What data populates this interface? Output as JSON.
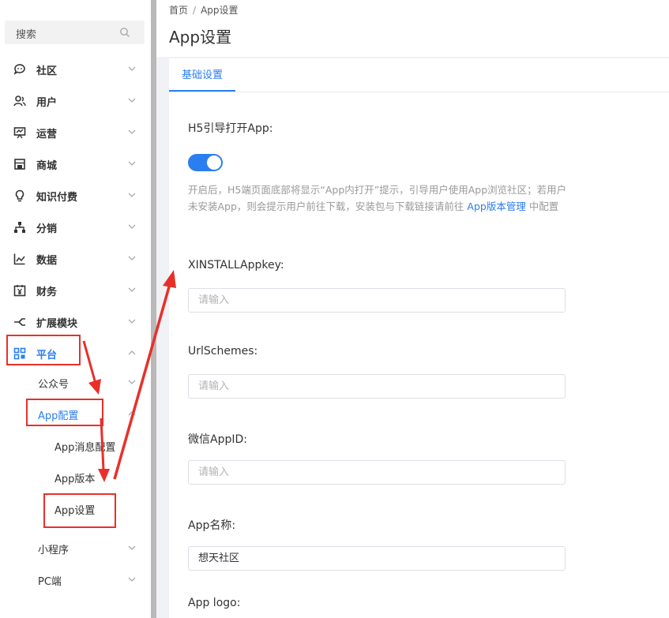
{
  "sidebar": {
    "search_placeholder": "搜索",
    "items": [
      {
        "label": "社区",
        "icon": "chat-icon"
      },
      {
        "label": "用户",
        "icon": "users-icon"
      },
      {
        "label": "运营",
        "icon": "presentation-icon"
      },
      {
        "label": "商城",
        "icon": "store-icon"
      },
      {
        "label": "知识付费",
        "icon": "lightbulb-icon"
      },
      {
        "label": "分销",
        "icon": "hierarchy-icon"
      },
      {
        "label": "数据",
        "icon": "chart-icon"
      },
      {
        "label": "财务",
        "icon": "yuan-calendar-icon"
      },
      {
        "label": "扩展模块",
        "icon": "extension-icon"
      },
      {
        "label": "平台",
        "icon": "grid-icon"
      }
    ],
    "platform_sub": {
      "gongzhonghao": "公众号",
      "app_config": "App配置",
      "app_msg_config": "App消息配置",
      "app_version": "App版本",
      "app_settings": "App设置",
      "mini_program": "小程序",
      "pc": "PC端"
    },
    "accent_color": "#2b7ef0"
  },
  "breadcrumb": {
    "home": "首页",
    "sep": "/",
    "current": "App设置"
  },
  "page_title": "App设置",
  "tabs": [
    {
      "label": "基础设置"
    }
  ],
  "form": {
    "h5_label": "H5引导打开App:",
    "h5_toggle_on": true,
    "help_text": "开启后，H5端页面底部将显示“App内打开”提示，引导用户使用App浏览社区；若用户未安装App，则会提示用户前往下载，安装包与下载链接请前往",
    "help_link": "App版本管理",
    "help_suffix": " 中配置",
    "xinstall_label": "XINSTALLAppkey:",
    "xinstall_placeholder": "请输入",
    "urlschemes_label": "UrlSchemes:",
    "urlschemes_placeholder": "请输入",
    "wechat_label": "微信AppID:",
    "wechat_placeholder": "请输入",
    "appname_label": "App名称:",
    "appname_value": "想天社区",
    "applogo_label": "App logo:"
  },
  "annotation_color": "#e8302a"
}
